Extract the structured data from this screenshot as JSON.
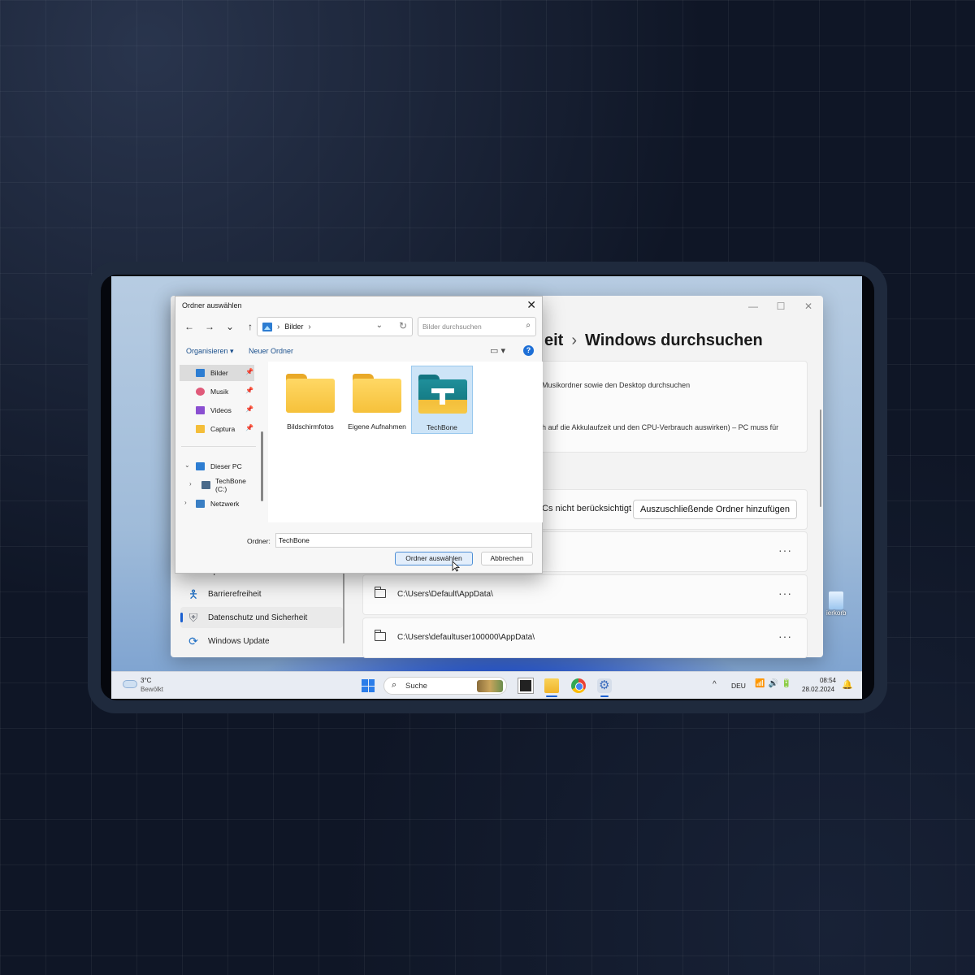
{
  "settings_window": {
    "breadcrumb_prev": "eit",
    "breadcrumb_sep": "›",
    "title": "Windows durchsuchen",
    "controls": {
      "minimize": "—",
      "maximize": "☐",
      "close": "✕"
    },
    "card_line1": "Musikordner sowie den Desktop durchsuchen",
    "card_line2": "h auf die Akkulaufzeit und den CPU-Verbrauch auswirken) – PC muss für",
    "exclude_text": "Cs nicht berücksichtigt",
    "exclude_button": "Auszuschließende Ordner hinzufügen",
    "excluded_folders": [
      {
        "path": "",
        "more": "···"
      },
      {
        "path": "C:\\Users\\Default\\AppData\\",
        "more": "···"
      },
      {
        "path": "C:\\Users\\defaultuser100000\\AppData\\",
        "more": "···"
      }
    ],
    "nav_partial": "Spielen",
    "nav_items": [
      {
        "label": "Barrierefreiheit",
        "icon": "accessibility-icon"
      },
      {
        "label": "Datenschutz und Sicherheit",
        "icon": "shield-icon",
        "active": true
      },
      {
        "label": "Windows Update",
        "icon": "windows-update-icon"
      }
    ]
  },
  "dialog": {
    "title": "Ordner auswählen",
    "close": "✕",
    "nav": {
      "back": "←",
      "forward": "→",
      "recent": "⌄",
      "up": "↑"
    },
    "address": {
      "chevron_before": "›",
      "location": "Bilder",
      "chevron_after": "›",
      "dropdown": "⌄",
      "refresh": "↻"
    },
    "search": {
      "placeholder": "Bilder durchsuchen",
      "icon": "⌕"
    },
    "commands": {
      "organize": "Organisieren ▾",
      "new_folder": "Neuer Ordner",
      "view": "▭ ▾",
      "help": "?"
    },
    "quick_access": [
      {
        "label": "Bilder",
        "color": "#2d7dd2",
        "pin": "📌",
        "selected": true
      },
      {
        "label": "Musik",
        "color": "#e05a7a",
        "pin": "📌"
      },
      {
        "label": "Videos",
        "color": "#8a4fd1",
        "pin": "📌"
      },
      {
        "label": "Captura",
        "color": "#f4be3a",
        "pin": "📌"
      }
    ],
    "tree": [
      {
        "label": "Dieser PC",
        "expander": "⌄",
        "color": "#2d7dd2"
      },
      {
        "label": "TechBone (C:)",
        "expander": "›",
        "color": "#4a6a8a"
      },
      {
        "label": "Netzwerk",
        "expander": "›",
        "color": "#3a7fc4"
      }
    ],
    "folders": [
      {
        "name": "Bildschirmfotos"
      },
      {
        "name": "Eigene Aufnahmen"
      },
      {
        "name": "TechBone",
        "selected": true
      }
    ],
    "folder_label": "Ordner:",
    "folder_value": "TechBone",
    "ok_button": "Ordner auswählen",
    "cancel_button": "Abbrechen"
  },
  "desktop": {
    "recycle_label": "ierkorb"
  },
  "taskbar": {
    "weather_temp": "3°C",
    "weather_desc": "Bewölkt",
    "search_label": "Suche",
    "search_icon": "⌕",
    "tray_up": "^",
    "language": "DEU",
    "tray_icons": "📶🔊🔋",
    "time": "08:54",
    "date": "28.02.2024",
    "bell": "🔔"
  }
}
